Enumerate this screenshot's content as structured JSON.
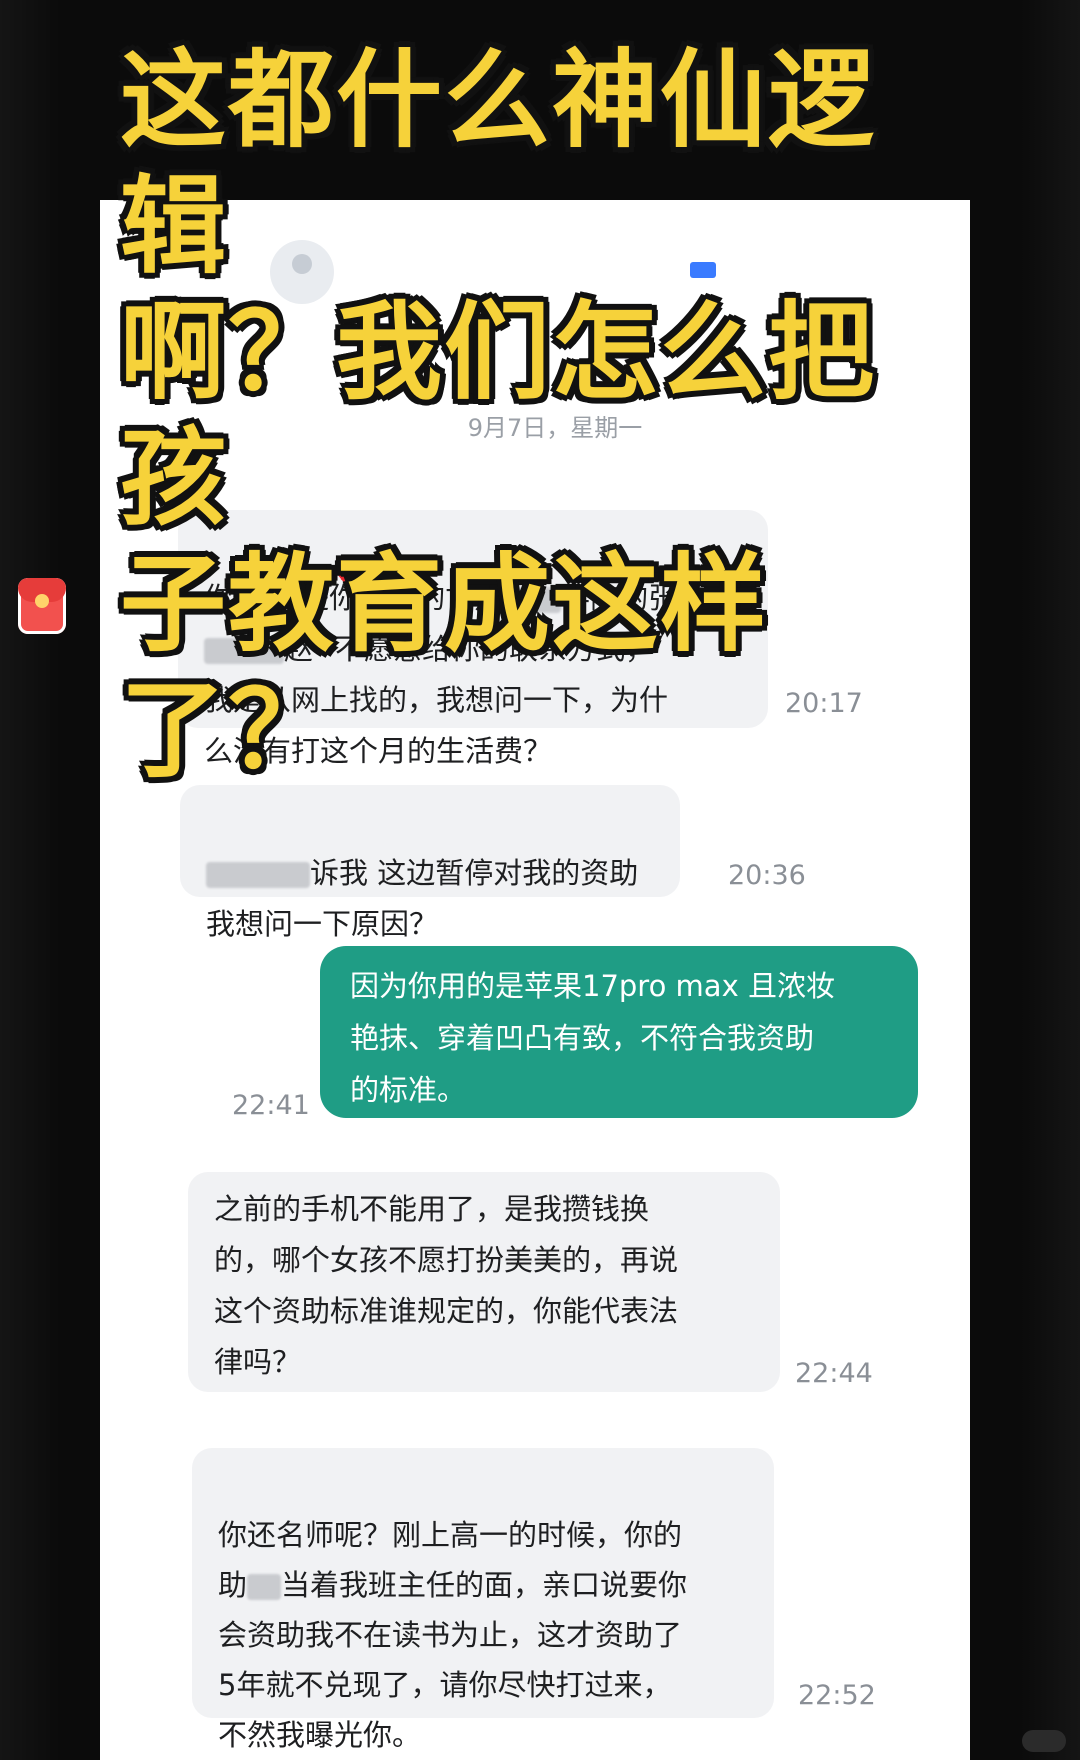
{
  "headline": {
    "line1": "这都什么神仙逻辑",
    "line2": "啊？我们怎么把孩",
    "line3": "子教育成这样了？"
  },
  "chat": {
    "date_label": "9月7日，星期一",
    "messages": [
      {
        "direction": "in",
        "lines": [
          "你好 我是你资助的甘肃",
          "学院的张",
          "赵",
          "不愿意给你的联系方式，",
          "我是从网上找的，我想问一下，为什",
          "么没有打这个月的生活费？"
        ],
        "time": "20:17"
      },
      {
        "direction": "in",
        "lines": [
          "诉我 这边暂停对我的资助",
          "我想问一下原因？"
        ],
        "time": "20:36"
      },
      {
        "direction": "out",
        "text": "因为你用的是苹果17pro max 且浓妆\n艳抹、穿着凹凸有致，不符合我资助\n的标准。",
        "time": "22:41"
      },
      {
        "direction": "in",
        "text": "之前的手机不能用了，是我攒钱换\n的，哪个女孩不愿打扮美美的，再说\n这个资助标准谁规定的，你能代表法\n律吗？",
        "time": "22:44"
      },
      {
        "direction": "in",
        "lines": [
          "你还名师呢？刚上高一的时候，你的",
          "助",
          "当着我班主任的面，亲口说要你",
          "会资助我不在读书为止，这才资助了",
          "5年就不兑现了，请你尽快打过来，",
          "不然我曝光你。"
        ],
        "time": "22:52"
      }
    ]
  },
  "colors": {
    "headline": "#f6d23a",
    "outgoing_bubble": "#1f9d85",
    "incoming_bubble": "#f1f2f4",
    "red_envelope": "#f2514e"
  },
  "icons": {
    "floating": "red-envelope-icon",
    "profile": "avatar"
  }
}
